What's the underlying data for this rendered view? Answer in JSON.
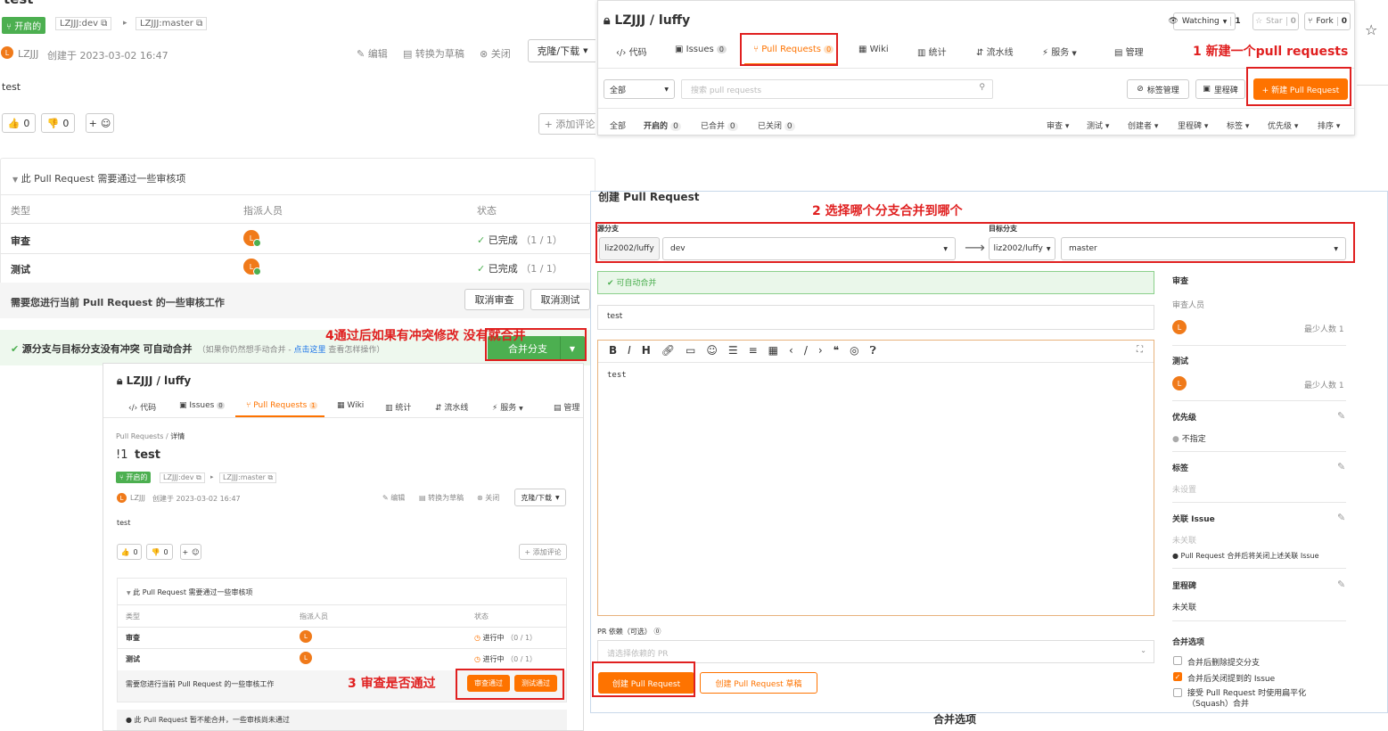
{
  "left": {
    "title_partial": "test",
    "status": "开启的",
    "src_branch": "LZJJJ:dev",
    "dst_branch": "LZJJJ:master",
    "author": "LZJJJ",
    "created": "创建于 2023-03-02 16:47",
    "actions": {
      "edit": "编辑",
      "draft": "转换为草稿",
      "close": "关闭",
      "clone": "克隆/下载"
    },
    "body": "test",
    "thumbs_up": "0",
    "thumbs_down": "0",
    "react": "+",
    "add_comment": "+ 添加评论",
    "review_header": "此 Pull Request 需要通过一些审核项",
    "cols": {
      "type": "类型",
      "assignee": "指派人员",
      "status": "状态"
    },
    "rows": [
      {
        "type": "审查",
        "status": "已完成",
        "count": "（1 / 1）"
      },
      {
        "type": "测试",
        "status": "已完成",
        "count": "（1 / 1）"
      }
    ],
    "need": "需要您进行当前 Pull Request 的一些审核工作",
    "cancel_review": "取消审查",
    "cancel_test": "取消测试",
    "merge_msg": "源分支与目标分支没有冲突 可自动合并",
    "merge_hint": "（如果你仍然想手动合并 - ",
    "merge_link": "点击这里",
    "merge_hint2": " 查看怎样操作）",
    "merge_btn": "合并分支"
  },
  "topright": {
    "repo": "LZJJJ / luffy",
    "watching": "Watching",
    "watch_count": "1",
    "star": "Star",
    "star_count": "0",
    "fork": "Fork",
    "fork_count": "0",
    "tabs": [
      {
        "label": "代码"
      },
      {
        "label": "Issues",
        "count": "0"
      },
      {
        "label": "Pull Requests",
        "count": "0"
      },
      {
        "label": "Wiki"
      },
      {
        "label": "统计"
      },
      {
        "label": "流水线"
      },
      {
        "label": "服务"
      },
      {
        "label": "管理"
      }
    ],
    "filter": "全部",
    "search_ph": "搜索 pull requests",
    "label_mgmt": "标签管理",
    "milestone": "里程碑",
    "new_pr": "+ 新建 Pull Request",
    "subtabs": [
      {
        "label": "全部"
      },
      {
        "label": "开启的",
        "count": "0"
      },
      {
        "label": "已合并",
        "count": "0"
      },
      {
        "label": "已关闭",
        "count": "0"
      }
    ],
    "filters": [
      "审查",
      "测试",
      "创建者",
      "里程碑",
      "标签",
      "优先级",
      "排序"
    ]
  },
  "create": {
    "title": "创建 Pull Request",
    "src_label": "源分支",
    "dst_label": "目标分支",
    "src_repo": "liz2002/luffy",
    "src_branch": "dev",
    "dst_repo": "liz2002/luffy",
    "dst_branch": "master",
    "auto": "可自动合并",
    "pr_title": "test",
    "body": "test",
    "dep_label": "PR 依赖（可选）",
    "dep_ph": "请选择依赖的 PR",
    "create_btn": "创建 Pull Request",
    "draft_btn": "创建 Pull Request 草稿",
    "bottom_text": "合并选项",
    "side": {
      "review": "审查",
      "reviewer": "审查人员",
      "min1": "最少人数 1",
      "test": "测试",
      "min2": "最少人数 1",
      "priority": "优先级",
      "priority_val": "不指定",
      "labels": "标签",
      "labels_val": "未设置",
      "issue": "关联 Issue",
      "issue_val": "未关联",
      "issue_note": "Pull Request 合并后将关闭上述关联 Issue",
      "milestone": "里程碑",
      "milestone_val": "未关联",
      "merge_opts": "合并选项",
      "opt1": "合并后删除提交分支",
      "opt2": "合并后关闭提到的 Issue",
      "opt3": "接受 Pull Request 时使用扁平化（Squash）合并"
    }
  },
  "bottomleft": {
    "repo": "LZJJJ / luffy",
    "tabs": [
      {
        "label": "代码"
      },
      {
        "label": "Issues",
        "count": "0"
      },
      {
        "label": "Pull Requests",
        "count": "1"
      },
      {
        "label": "Wiki"
      },
      {
        "label": "统计"
      },
      {
        "label": "流水线"
      },
      {
        "label": "服务"
      },
      {
        "label": "管理"
      }
    ],
    "crumb1": "Pull Requests",
    "crumb_sep": "/",
    "crumb2": "详情",
    "num": "!1",
    "title": "test",
    "status": "开启的",
    "src": "LZJJJ:dev",
    "dst": "LZJJJ:master",
    "author": "LZJJJ",
    "created": "创建于 2023-03-02 16:47",
    "actions": {
      "edit": "编辑",
      "draft": "转换为草稿",
      "close": "关闭",
      "clone": "克隆/下载"
    },
    "body": "test",
    "thumbs_up": "0",
    "thumbs_down": "0",
    "react": "+",
    "add_comment": "+ 添加评论",
    "review_header": "此 Pull Request 需要通过一些审核项",
    "cols": {
      "type": "类型",
      "assignee": "指派人员",
      "status": "状态"
    },
    "rows": [
      {
        "type": "审查",
        "status": "进行中",
        "count": "（0 / 1）"
      },
      {
        "type": "测试",
        "status": "进行中",
        "count": "（0 / 1）"
      }
    ],
    "need": "需要您进行当前 Pull Request 的一些审核工作",
    "approve_review": "审查通过",
    "approve_test": "测试通过",
    "cannot": "此 Pull Request 暂不能合并，一些审核尚未通过"
  },
  "annotations": {
    "a1": "1 新建一个pull requests",
    "a2": "2 选择哪个分支合并到哪个",
    "a3": "3 审查是否通过",
    "a4": "4通过后如果有冲突修改 没有就合并"
  },
  "colors": {
    "orange": "#fe7300",
    "green": "#4caf50",
    "red": "#e02020"
  }
}
